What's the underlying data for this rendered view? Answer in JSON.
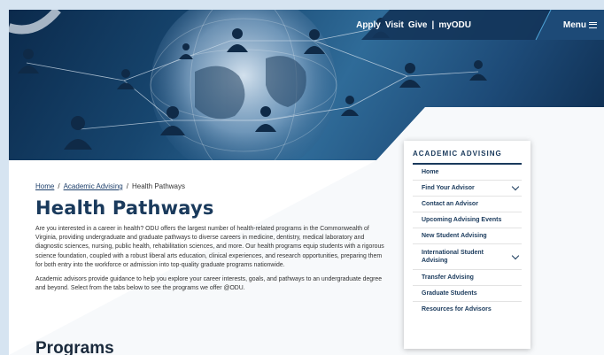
{
  "topnav": {
    "links": [
      "Apply",
      "Visit",
      "Give"
    ],
    "myodu": "myODU",
    "menu_label": "Menu"
  },
  "breadcrumb": {
    "home": "Home",
    "sep": "/",
    "parent": "Academic Advising",
    "current": "Health Pathways"
  },
  "page": {
    "title": "Health Pathways",
    "intro": "Are you interested in a career in health? ODU offers the largest number of health-related programs in the Commonwealth of Virginia, providing undergraduate and graduate pathways to diverse careers in medicine, dentistry, medical laboratory and diagnostic sciences, nursing, public health, rehabilitation sciences, and more. Our health programs equip students with a rigorous science foundation, coupled with a robust liberal arts education, clinical experiences, and research opportunities, preparing them for both entry into the workforce or admission into top-quality graduate programs nationwide.",
    "advisors": "Academic advisors provide guidance to help you explore your career interests, goals, and pathways to an undergraduate degree and beyond. Select from the tabs below to see the programs we offer @ODU.",
    "programs_heading": "Programs"
  },
  "sidebar": {
    "heading": "ACADEMIC ADVISING",
    "items": [
      {
        "label": "Home",
        "expandable": false
      },
      {
        "label": "Find Your Advisor",
        "expandable": true
      },
      {
        "label": "Contact an Advisor",
        "expandable": false
      },
      {
        "label": "Upcoming Advising Events",
        "expandable": false
      },
      {
        "label": "New Student Advising",
        "expandable": false
      },
      {
        "label": "International Student Advising",
        "expandable": true
      },
      {
        "label": "Transfer Advising",
        "expandable": false
      },
      {
        "label": "Graduate Students",
        "expandable": false
      },
      {
        "label": "Resources for Advisors",
        "expandable": false
      }
    ]
  },
  "colors": {
    "brand_navy": "#1a3a5c",
    "frame": "#d6e4f1"
  },
  "icons": [
    "hamburger-icon",
    "chevron-down-icon",
    "person-icon",
    "globe-graphic"
  ]
}
